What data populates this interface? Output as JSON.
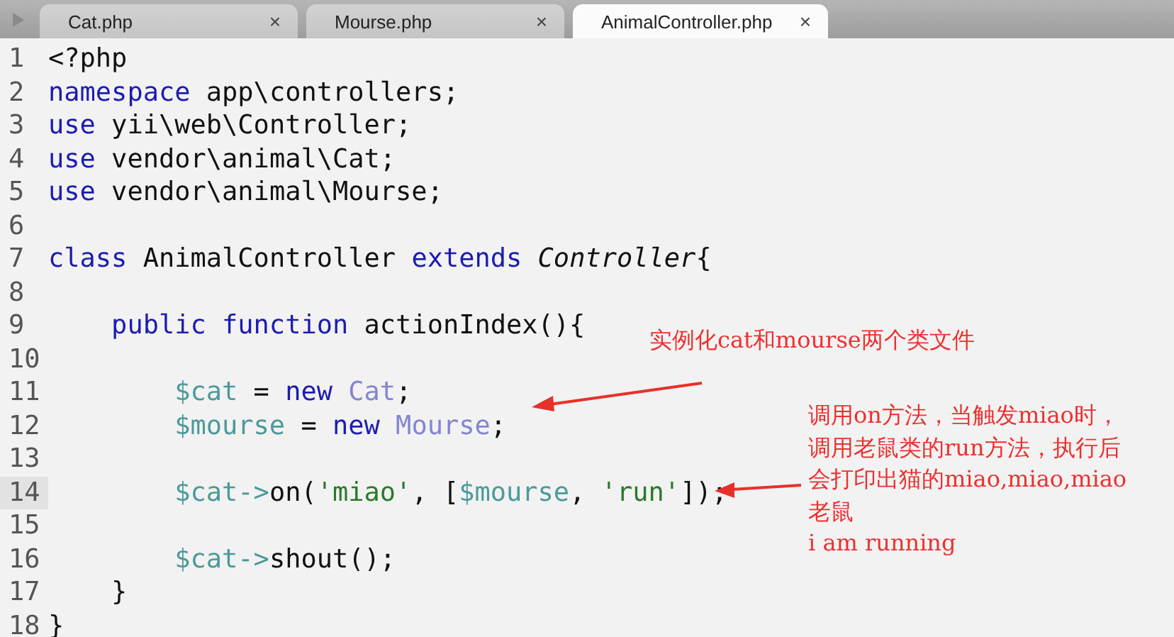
{
  "tabs": [
    {
      "label": "Cat.php",
      "close": "×",
      "selected": false
    },
    {
      "label": "Mourse.php",
      "close": "×",
      "selected": false
    },
    {
      "label": "AnimalController.php",
      "close": "×",
      "selected": true
    }
  ],
  "editor": {
    "lines": [
      {
        "number": "1",
        "current": false,
        "tokens": [
          {
            "text": "<?php",
            "kind": "plain"
          }
        ]
      },
      {
        "number": "2",
        "current": false,
        "tokens": [
          {
            "text": "namespace",
            "kind": "keyword"
          },
          {
            "text": " app\\controllers;",
            "kind": "plain"
          }
        ]
      },
      {
        "number": "3",
        "current": false,
        "tokens": [
          {
            "text": "use",
            "kind": "keyword"
          },
          {
            "text": " yii\\web\\Controller;",
            "kind": "plain"
          }
        ]
      },
      {
        "number": "4",
        "current": false,
        "tokens": [
          {
            "text": "use",
            "kind": "keyword"
          },
          {
            "text": " vendor\\animal\\Cat;",
            "kind": "plain"
          }
        ]
      },
      {
        "number": "5",
        "current": false,
        "tokens": [
          {
            "text": "use",
            "kind": "keyword"
          },
          {
            "text": " vendor\\animal\\Mourse;",
            "kind": "plain"
          }
        ]
      },
      {
        "number": "6",
        "current": false
      },
      {
        "number": "7",
        "current": false,
        "tokens": [
          {
            "text": "class",
            "kind": "keyword"
          },
          {
            "text": " AnimalController ",
            "kind": "plain"
          },
          {
            "text": "extends",
            "kind": "keyword"
          },
          {
            "text": " Controller",
            "kind": "italic"
          },
          {
            "text": "{",
            "kind": "plain"
          }
        ]
      },
      {
        "number": "8",
        "current": false
      },
      {
        "number": "9",
        "current": false,
        "tokens": [
          {
            "text": "    public function",
            "kind": "keyword"
          },
          {
            "text": " actionIndex(){",
            "kind": "plain"
          }
        ]
      },
      {
        "number": "10",
        "current": false
      },
      {
        "number": "11",
        "current": false,
        "tokens": [
          {
            "text": "        $cat",
            "kind": "variable"
          },
          {
            "text": " = ",
            "kind": "plain"
          },
          {
            "text": "new",
            "kind": "keyword"
          },
          {
            "text": " Cat",
            "kind": "class"
          },
          {
            "text": ";",
            "kind": "plain"
          }
        ]
      },
      {
        "number": "12",
        "current": false,
        "tokens": [
          {
            "text": "        $mourse",
            "kind": "variable"
          },
          {
            "text": " = ",
            "kind": "plain"
          },
          {
            "text": "new",
            "kind": "keyword"
          },
          {
            "text": " Mourse",
            "kind": "class"
          },
          {
            "text": ";",
            "kind": "plain"
          }
        ]
      },
      {
        "number": "13",
        "current": false
      },
      {
        "number": "14",
        "current": true,
        "tokens": [
          {
            "text": "        $cat->",
            "kind": "variable"
          },
          {
            "text": "on(",
            "kind": "plain"
          },
          {
            "text": "'miao'",
            "kind": "string"
          },
          {
            "text": ", [",
            "kind": "plain"
          },
          {
            "text": "$mourse",
            "kind": "variable"
          },
          {
            "text": ", ",
            "kind": "plain"
          },
          {
            "text": "'run'",
            "kind": "string"
          },
          {
            "text": "]);",
            "kind": "plain"
          }
        ]
      },
      {
        "number": "15",
        "current": false
      },
      {
        "number": "16",
        "current": false,
        "tokens": [
          {
            "text": "        $cat->",
            "kind": "variable"
          },
          {
            "text": "shout();",
            "kind": "plain"
          }
        ]
      },
      {
        "number": "17",
        "current": false,
        "tokens": [
          {
            "text": "    }",
            "kind": "plain"
          }
        ]
      },
      {
        "number": "18",
        "current": false,
        "tokens": [
          {
            "text": "}",
            "kind": "plain"
          }
        ]
      }
    ]
  },
  "annotations": [
    {
      "lines": [
        "实例化cat和mourse两个类文件"
      ]
    },
    {
      "lines": [
        "调用on方法，当触发miao时，",
        "调用老鼠类的run方法，执行后",
        "会打印出猫的miao,miao,miao",
        "老鼠",
        "i am running"
      ]
    }
  ]
}
